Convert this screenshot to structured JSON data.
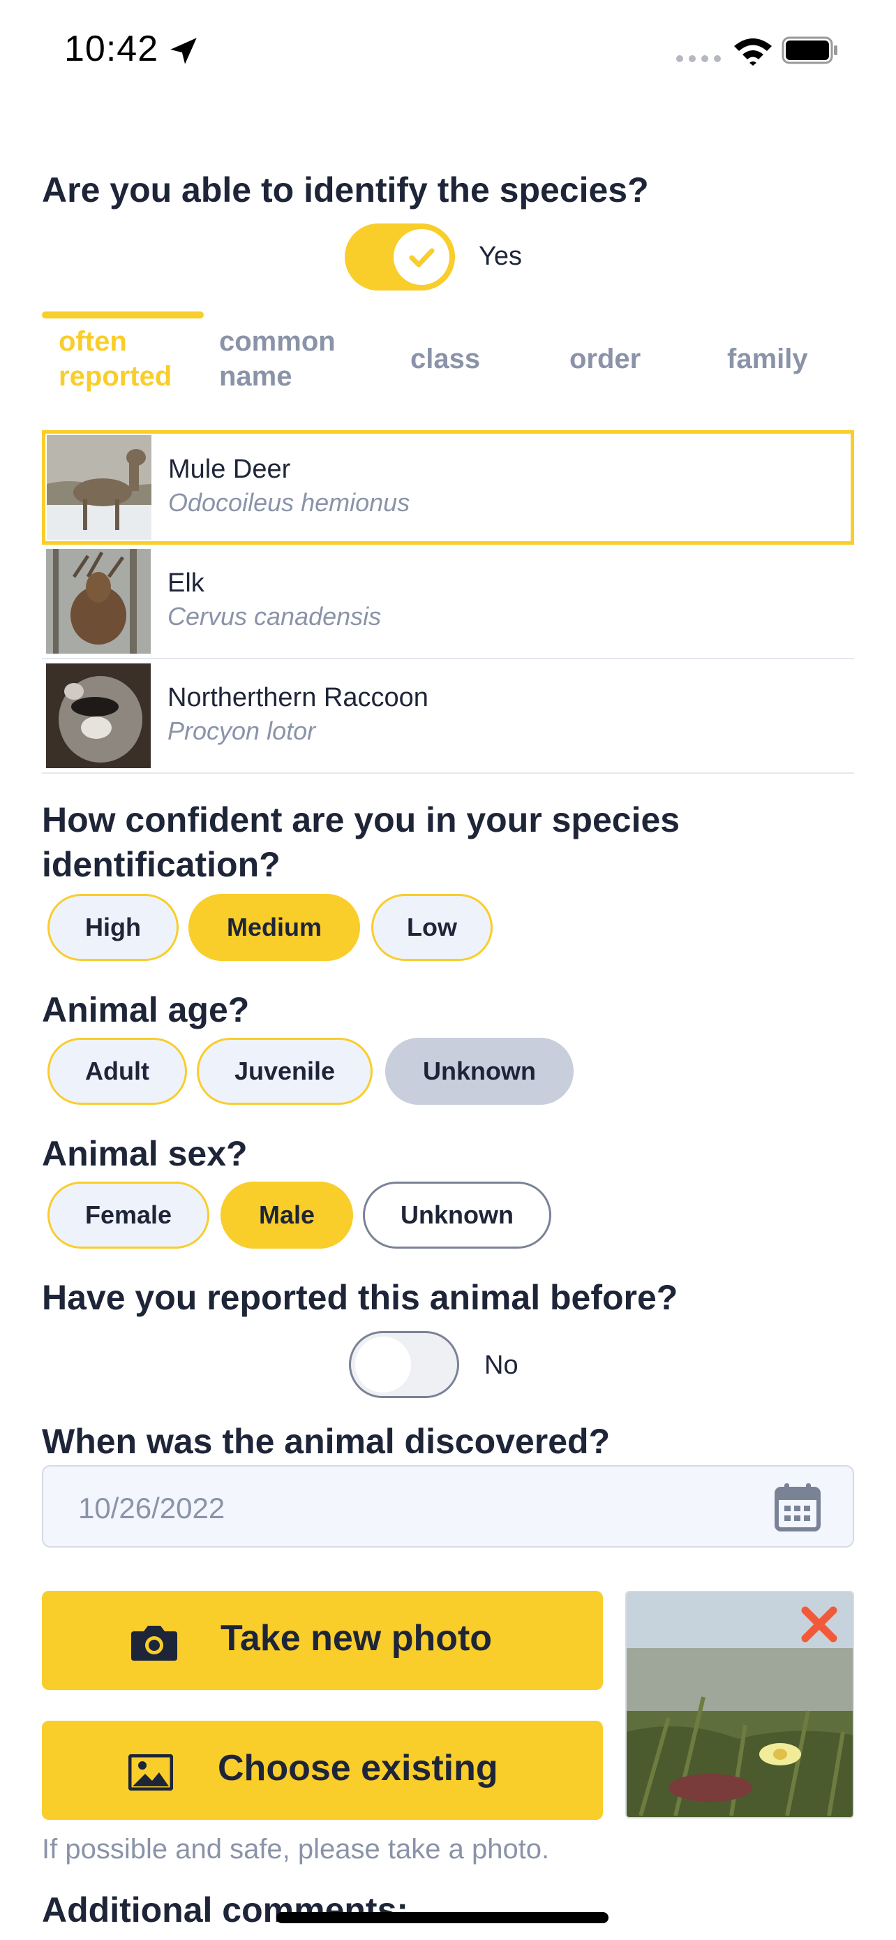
{
  "status_bar": {
    "time": "10:42"
  },
  "identify": {
    "question": "Are you able to identify the species?",
    "toggle_label": "Yes",
    "toggle_on": true
  },
  "tabs": [
    {
      "label": "often reported",
      "active": true
    },
    {
      "label": "common name"
    },
    {
      "label": "class"
    },
    {
      "label": "order"
    },
    {
      "label": "family"
    }
  ],
  "species": [
    {
      "name": "Mule Deer",
      "scientific": "Odocoileus hemionus",
      "selected": true
    },
    {
      "name": "Elk",
      "scientific": "Cervus canadensis"
    },
    {
      "name": "Northerthern Raccoon",
      "scientific": "Procyon lotor"
    }
  ],
  "confidence": {
    "question": "How confident are you in your species identification?",
    "options": [
      "High",
      "Medium",
      "Low"
    ],
    "selected": "Medium"
  },
  "age": {
    "question": "Animal age?",
    "options": [
      "Adult",
      "Juvenile",
      "Unknown"
    ],
    "selected": "Unknown"
  },
  "sex": {
    "question": "Animal sex?",
    "options": [
      "Female",
      "Male",
      "Unknown"
    ],
    "selected": "Male"
  },
  "reported_before": {
    "question": "Have you reported this animal before?",
    "toggle_label": "No",
    "toggle_on": false
  },
  "discovered": {
    "question": "When was the animal discovered?",
    "date_placeholder": "10/26/2022"
  },
  "photo": {
    "take_label": "Take new photo",
    "choose_label": "Choose existing",
    "hint": "If possible and safe, please take a photo."
  },
  "comments": {
    "label": "Additional comments:"
  },
  "colors": {
    "accent": "#f9cd2a",
    "text": "#1e2538",
    "muted": "#8a93a8",
    "delete": "#f05a3a"
  },
  "icons": [
    "location-arrow-icon",
    "wifi-icon",
    "battery-icon",
    "checkmark-icon",
    "calendar-icon",
    "camera-icon",
    "image-icon",
    "close-icon"
  ]
}
